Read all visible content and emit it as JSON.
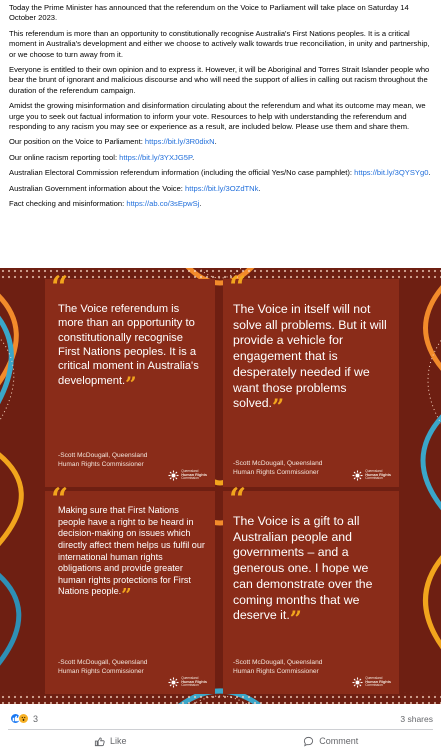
{
  "post": {
    "paragraphs": [
      "Today the Prime Minister has announced that the referendum on the Voice to Parliament will take place on Saturday 14 October 2023.",
      "This referendum is more than an opportunity to constitutionally recognise Australia's First Nations peoples. It is a critical moment in Australia's development and either we choose to actively walk towards true reconciliation, in unity and partnership, or we choose to turn away from it.",
      "Everyone is entitled to their own opinion and to express it.  However, it will be Aboriginal and Torres Strait Islander people who bear the brunt of ignorant and malicious discourse and who will need the support of allies in calling out racism throughout the duration of the referendum campaign.",
      "Amidst the growing misinformation and disinformation circulating about the referendum and what its outcome may mean, we urge you to seek out factual information to inform your vote. Resources to help with understanding the referendum and responding to any racism you may see or experience as a result, are included below. Please use them and share them."
    ],
    "links": [
      {
        "label": "Our position on the Voice to Parliament: ",
        "url": "https://bit.ly/3R0dixN",
        "suffix": "."
      },
      {
        "label": "Our online racism reporting tool: ",
        "url": "https://bit.ly/3YXJG5P",
        "suffix": "."
      },
      {
        "label": "Australian Electoral Commission referendum information (including the official Yes/No case pamphlet): ",
        "url": "https://bit.ly/3QYSYg0",
        "suffix": "."
      },
      {
        "label": "Australian Government information about the Voice: ",
        "url": "https://bit.ly/3OZdTNk",
        "suffix": "."
      },
      {
        "label": "Fact checking and misinformation: ",
        "url": "https://ab.co/3sEpwSj",
        "suffix": "."
      }
    ]
  },
  "quotes": [
    {
      "text": "The Voice referendum is more than an opportunity to constitutionally recognise First Nations peoples. It is a critical moment in Australia's development.",
      "attribution_line1": "-Scott McDougall, Queensland",
      "attribution_line2": "Human Rights Commissioner"
    },
    {
      "text": "The Voice in itself will not solve all problems. But it will provide a vehicle for engagement that is desperately needed if we want those problems solved.",
      "attribution_line1": "-Scott McDougall, Queensland",
      "attribution_line2": "Human Rights Commissioner"
    },
    {
      "text": "Making sure that First Nations people have a right to be heard in decision-making on issues which directly affect them helps us fulfil our international human rights obligations and provide greater human rights protections for First Nations people.",
      "attribution_line1": "-Scott McDougall, Queensland",
      "attribution_line2": "Human Rights Commissioner"
    },
    {
      "text": "The Voice is a gift to all Australian people and governments – and a generous one. I hope we can demonstrate over the coming months that we deserve it.",
      "attribution_line1": "-Scott McDougall, Queensland",
      "attribution_line2": "Human Rights Commissioner"
    }
  ],
  "logo": {
    "line1": "Queensland",
    "line2": "Human Rights",
    "line3": "Commission"
  },
  "footer": {
    "reaction_count": "3",
    "shares": "3 shares",
    "like_label": "Like",
    "comment_label": "Comment"
  },
  "colors": {
    "link": "#216fdb",
    "tile_bg": "#8a2c19",
    "quote_mark": "#f2a51d",
    "like_blue": "#1877f2"
  },
  "icons": [
    "like-icon",
    "wow-icon",
    "thumbs-up-icon",
    "comment-icon",
    "qhrc-logo-icon"
  ]
}
